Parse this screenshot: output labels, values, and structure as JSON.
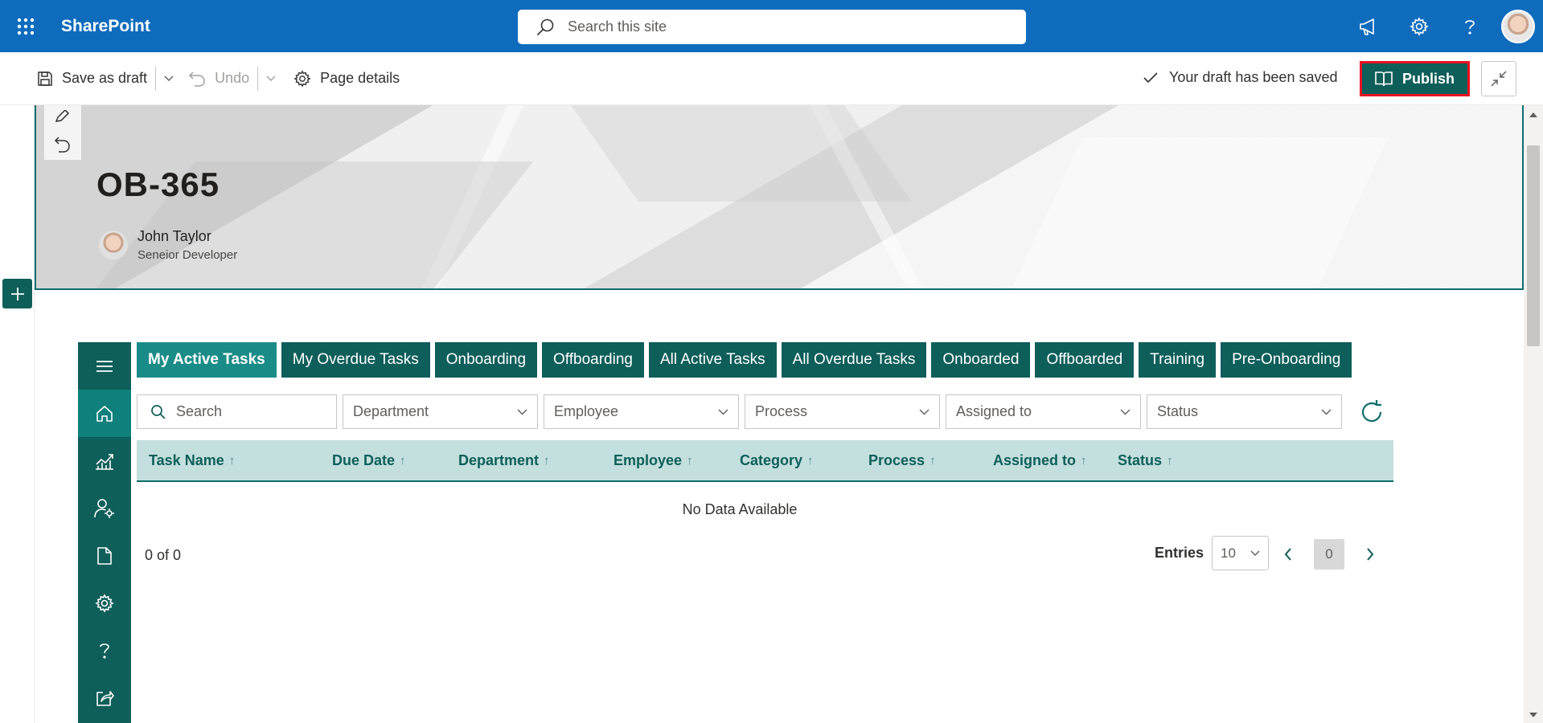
{
  "suite": {
    "brand": "SharePoint",
    "search_placeholder": "Search this site"
  },
  "command_bar": {
    "save_draft": "Save as draft",
    "undo": "Undo",
    "page_details": "Page details",
    "status": "Your draft has been saved",
    "publish": "Publish"
  },
  "hero": {
    "title": "OB-365",
    "author_name": "John Taylor",
    "author_role": "Seneior Developer"
  },
  "webpart": {
    "sidebar_icons": [
      "menu-icon",
      "home-icon",
      "analytics-icon",
      "user-settings-icon",
      "document-icon",
      "settings-icon",
      "help-icon",
      "share-icon"
    ],
    "tabs": [
      "My Active Tasks",
      "My Overdue Tasks",
      "Onboarding",
      "Offboarding",
      "All Active Tasks",
      "All Overdue Tasks",
      "Onboarded",
      "Offboarded",
      "Training",
      "Pre-Onboarding"
    ],
    "active_tab": "My Active Tasks",
    "filters": {
      "search_placeholder": "Search",
      "dropdowns": [
        "Department",
        "Employee",
        "Process",
        "Assigned to",
        "Status"
      ]
    },
    "columns": [
      "Task Name",
      "Due Date",
      "Department",
      "Employee",
      "Category",
      "Process",
      "Assigned to",
      "Status"
    ],
    "sort_indicator": "↑",
    "empty_message": "No Data Available",
    "count_text": "0 of 0",
    "entries_label": "Entries",
    "entries_value": "10",
    "page": "0"
  },
  "colors": {
    "suite_blue": "#0f6cbd",
    "teal_dark": "#0e5e5a",
    "teal_active": "#1a8c88",
    "header_bg": "#c3e0de",
    "publish_outline": "#e81123"
  }
}
